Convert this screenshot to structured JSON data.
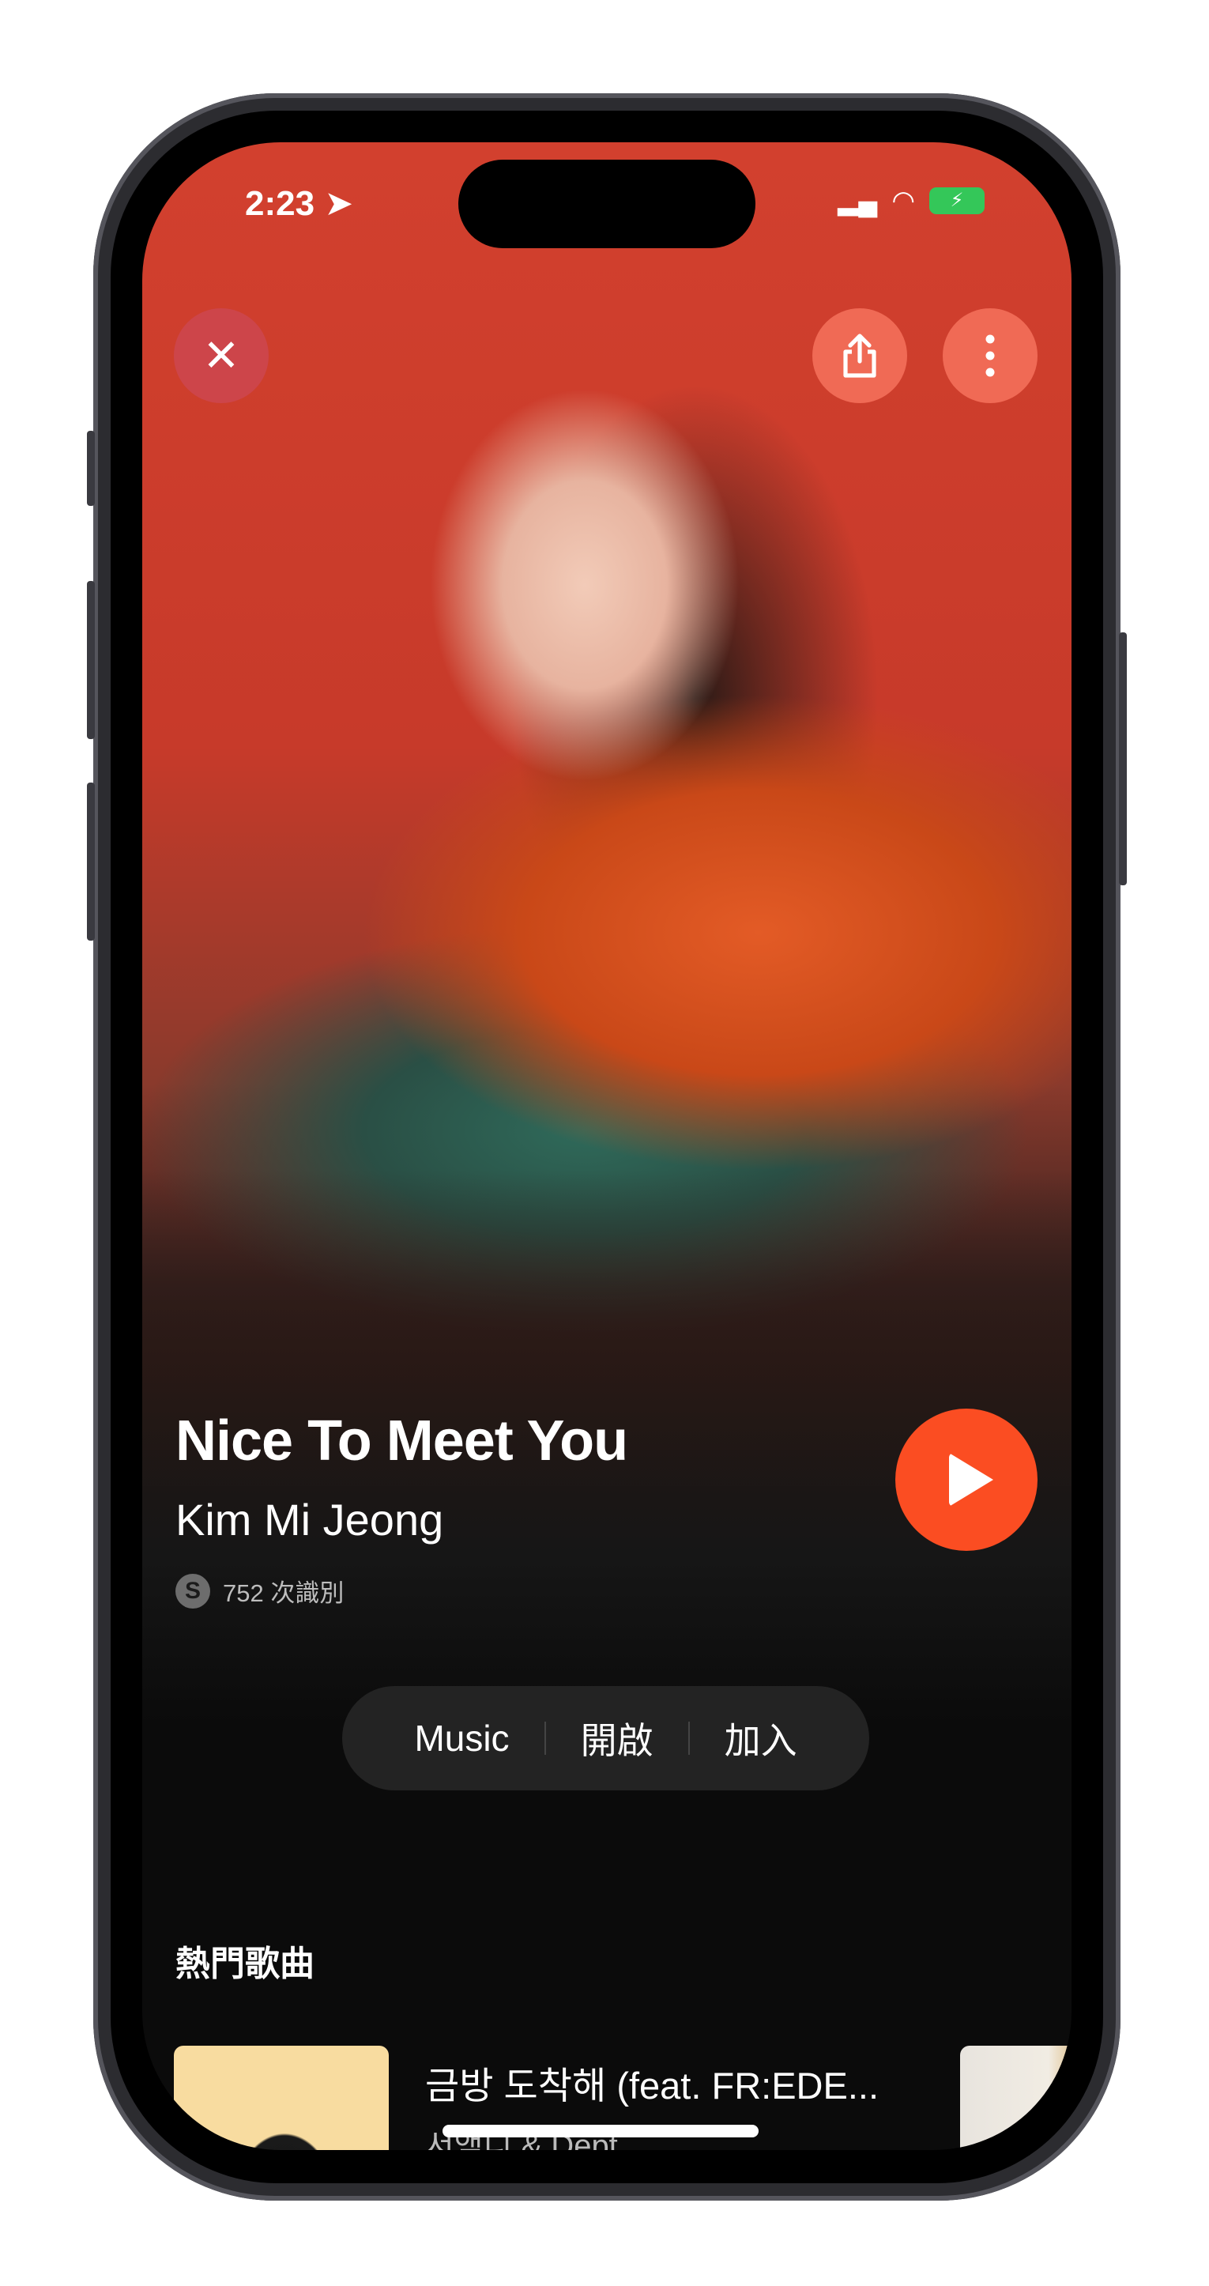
{
  "status_bar": {
    "time": "2:23",
    "battery_charging": true
  },
  "top_buttons": {
    "close_icon": "close-icon",
    "share_icon": "share-icon",
    "more_icon": "more-vertical-icon"
  },
  "song": {
    "title": "Nice To Meet You",
    "artist": "Kim Mi Jeong",
    "recognition_count": "752 次識別"
  },
  "colors": {
    "accent": "#fb4d22",
    "hero_red": "#c73a2a",
    "background": "#0b0b0b"
  },
  "apple_music": {
    "brand": "Music",
    "open_label": "開啟",
    "add_label": "加入"
  },
  "top_songs": {
    "heading": "熱門歌曲",
    "items": [
      {
        "title": "금방 도착해 (feat. FR:EDE...",
        "artist": "서액디 & Dept"
      }
    ]
  }
}
